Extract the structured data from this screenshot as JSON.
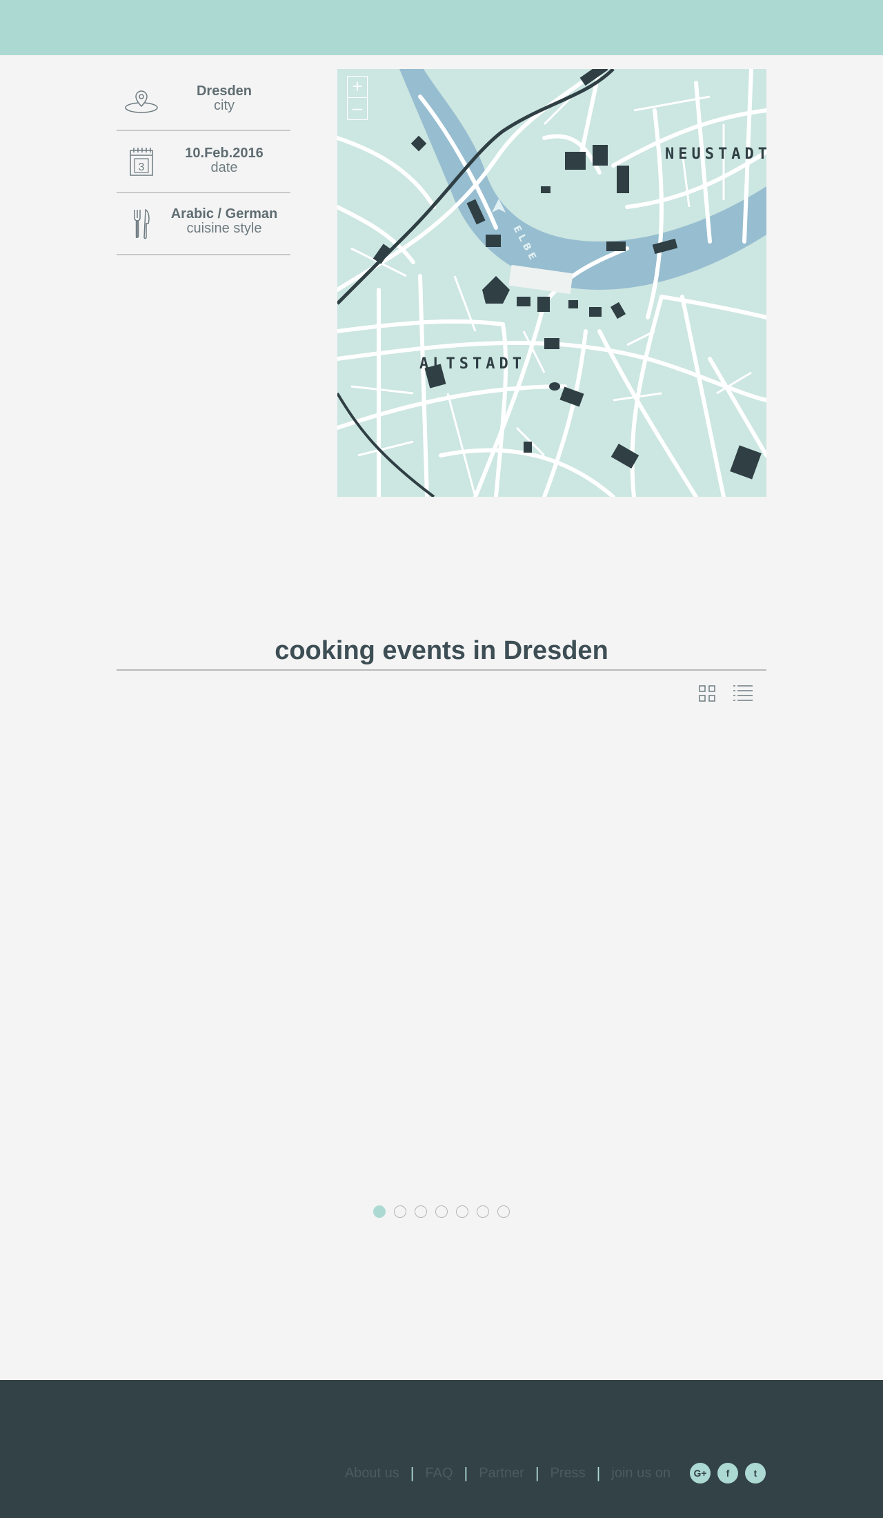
{
  "info": {
    "city": {
      "value": "Dresden",
      "label": "city",
      "icon": "location-pin-icon"
    },
    "date": {
      "value": "10.Feb.2016",
      "label": "date",
      "calendar_day": "3",
      "icon": "calendar-icon"
    },
    "cuisine": {
      "value": "Arabic / German",
      "label": "cuisine style",
      "icon": "fork-knife-icon"
    }
  },
  "map": {
    "district_north": "NEUSTADT",
    "district_south": "ALTSTADT",
    "river": "ELBE",
    "zoom_in": "+",
    "zoom_out": "–"
  },
  "events": {
    "title": "cooking events in Dresden",
    "views": [
      "grid-view-icon",
      "list-view-icon"
    ]
  },
  "pagination": {
    "count": 7,
    "active": 1
  },
  "footer": {
    "links": [
      "About us",
      "FAQ",
      "Partner",
      "Press"
    ],
    "join_text": "join us on",
    "social": [
      {
        "name": "google-plus-icon",
        "glyph": "G+"
      },
      {
        "name": "facebook-icon",
        "glyph": "f"
      },
      {
        "name": "twitter-icon",
        "glyph": "t"
      }
    ]
  },
  "colors": {
    "accent": "#acdad3",
    "footer": "#334247",
    "map_bg": "#cce6e1",
    "river": "#97bdd0",
    "building": "#2f3f44"
  }
}
